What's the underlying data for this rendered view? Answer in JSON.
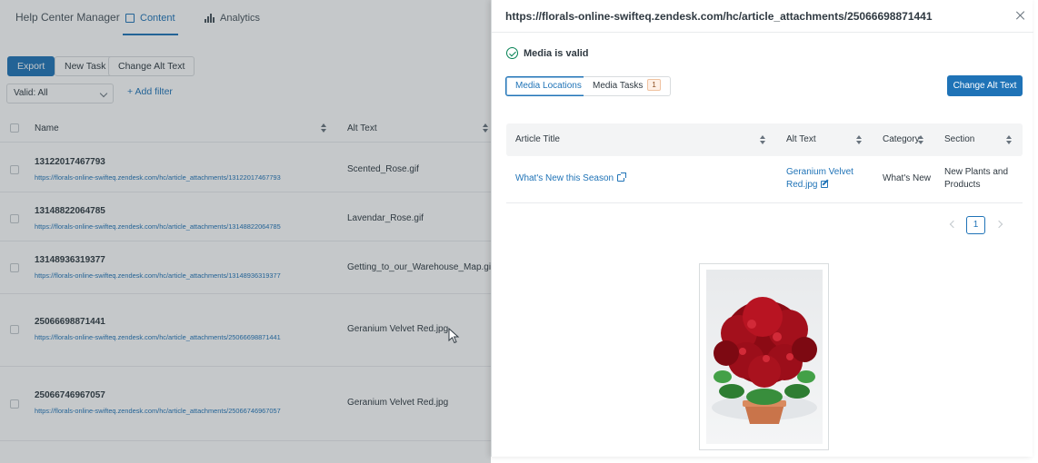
{
  "app": {
    "title": "Help Center Manager",
    "tabs": [
      {
        "label": "Content",
        "icon": "document-icon"
      },
      {
        "label": "Analytics",
        "icon": "bar-chart-icon"
      }
    ]
  },
  "toolbar": {
    "export_label": "Export",
    "new_task_label": "New Task",
    "change_alt_label": "Change Alt Text"
  },
  "filter": {
    "select_value": "Valid: All",
    "add_filter_label": "+ Add filter"
  },
  "table": {
    "columns": [
      "Name",
      "Alt Text"
    ],
    "rows": [
      {
        "id": "13122017467793",
        "url": "https://florals-online-swifteq.zendesk.com/hc/article_attachments/13122017467793",
        "alt": "Scented_Rose.gif"
      },
      {
        "id": "13148822064785",
        "url": "https://florals-online-swifteq.zendesk.com/hc/article_attachments/13148822064785",
        "alt": "Lavendar_Rose.gif"
      },
      {
        "id": "13148936319377",
        "url": "https://florals-online-swifteq.zendesk.com/hc/article_attachments/13148936319377",
        "alt": "Getting_to_our_Warehouse_Map.gif"
      },
      {
        "id": "25066698871441",
        "url": "https://florals-online-swifteq.zendesk.com/hc/article_attachments/25066698871441",
        "alt": "Geranium Velvet Red.jpg"
      },
      {
        "id": "25066746967057",
        "url": "https://florals-online-swifteq.zendesk.com/hc/article_attachments/25066746967057",
        "alt": "Geranium Velvet Red.jpg"
      }
    ]
  },
  "modal": {
    "title": "https://florals-online-swifteq.zendesk.com/hc/article_attachments/25066698871441",
    "status": "Media is valid",
    "tabs": [
      {
        "label": "Media Locations",
        "active": true
      },
      {
        "label": "Media Tasks",
        "badge": "1"
      }
    ],
    "change_alt_button": "Change Alt Text",
    "columns": [
      "Article Title",
      "Alt Text",
      "Category",
      "Section"
    ],
    "rows": [
      {
        "article_title": "What's New this Season",
        "alt_text_line1": "Geranium Velvet",
        "alt_text_line2": "Red.jpg",
        "category": "What's New",
        "section_line1": "New Plants and",
        "section_line2": "Products"
      }
    ],
    "pagination": {
      "current_page": "1"
    }
  },
  "colors": {
    "primary": "#1f73b7",
    "success": "#038153",
    "text": "#2f3941"
  }
}
